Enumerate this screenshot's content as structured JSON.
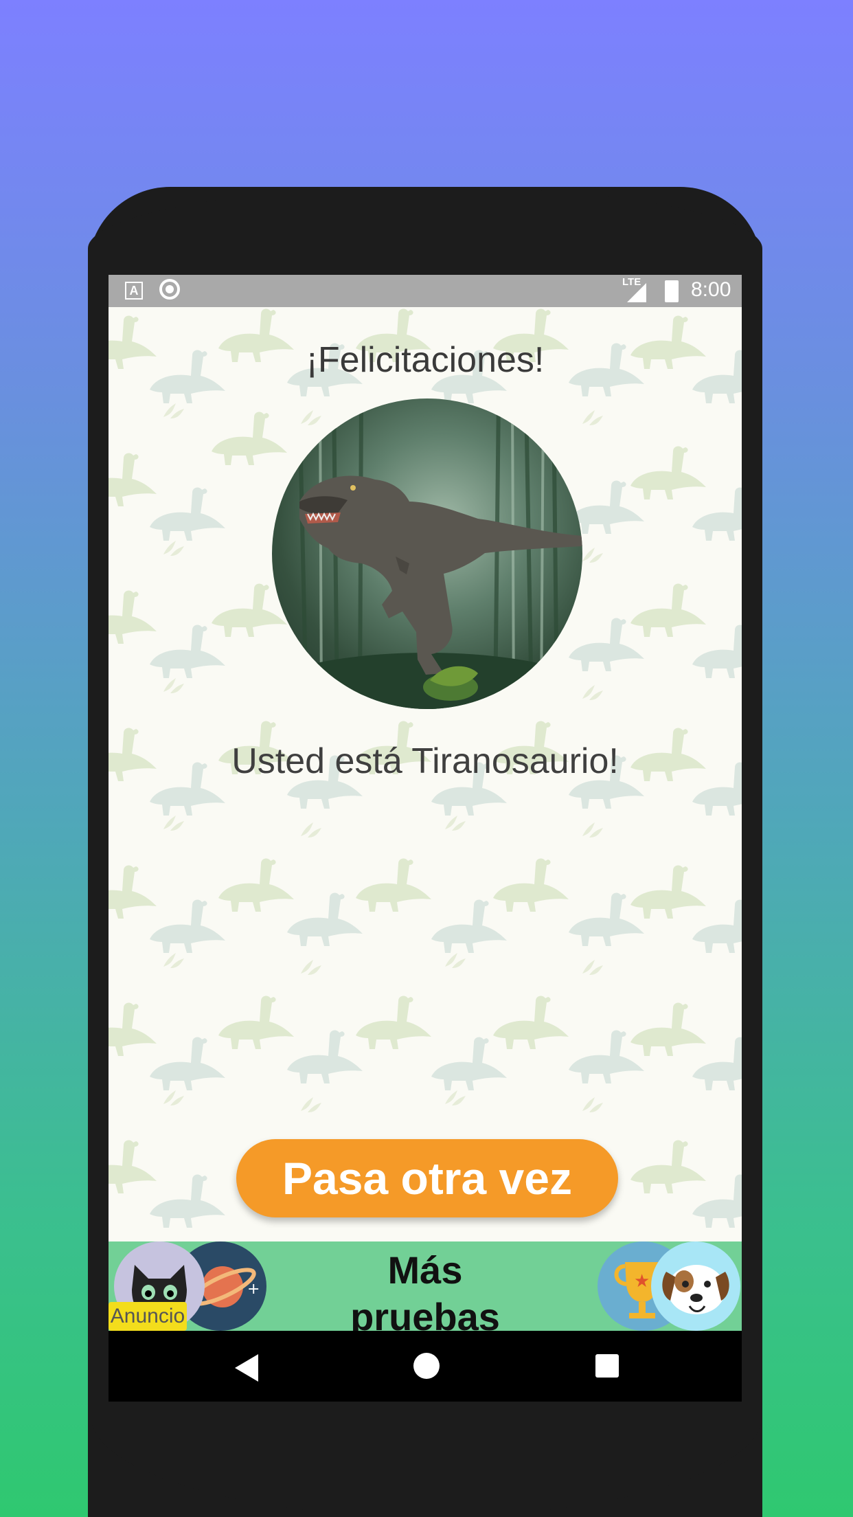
{
  "status_bar": {
    "time": "8:00",
    "network": "LTE",
    "notification_icons": [
      "text-notification-icon",
      "circle-notification-icon"
    ]
  },
  "content": {
    "title": "¡Felicitaciones!",
    "result_text": "Usted está Tiranosaurio!",
    "image_subject": "tyrannosaurus-in-bamboo-forest",
    "retry_button": "Pasa otra vez"
  },
  "ad_bar": {
    "ad_label": "Anuncio",
    "more_tests_line1": "Más",
    "more_tests_line2": "pruebas"
  },
  "nav_bar": {
    "buttons": [
      "back",
      "home",
      "recents"
    ]
  },
  "colors": {
    "background_top": "#7d80ff",
    "background_bottom": "#2fc870",
    "button": "#f59a28",
    "ad_bar": "#72d096",
    "status_bar": "#a9a9a9"
  }
}
